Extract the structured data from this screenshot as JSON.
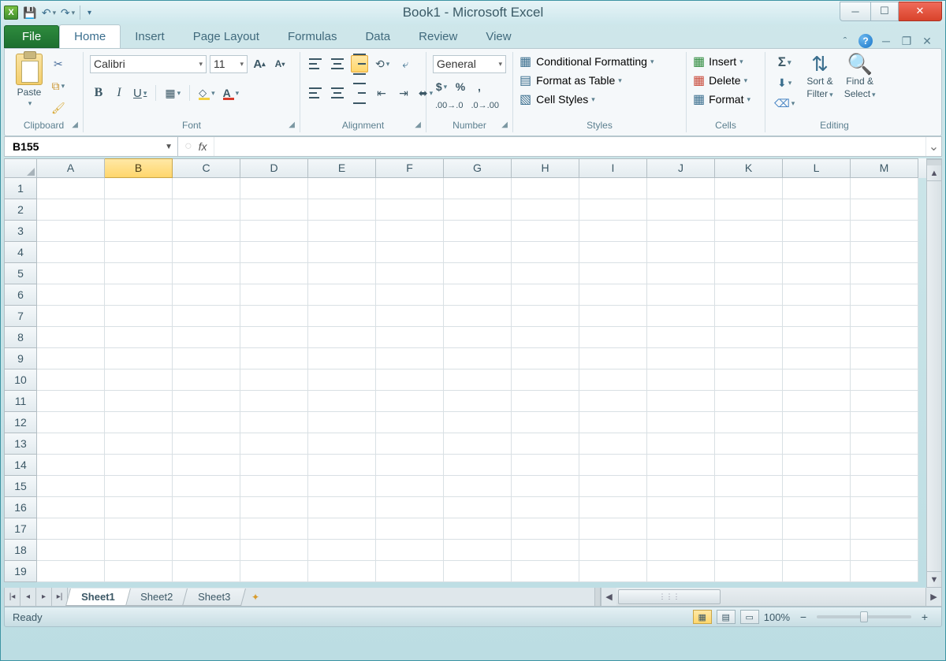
{
  "title": "Book1 - Microsoft Excel",
  "tabs": {
    "file": "File",
    "list": [
      "Home",
      "Insert",
      "Page Layout",
      "Formulas",
      "Data",
      "Review",
      "View"
    ],
    "active": "Home"
  },
  "ribbon": {
    "clipboard": {
      "label": "Clipboard",
      "paste": "Paste"
    },
    "font": {
      "label": "Font",
      "name": "Calibri",
      "size": "11",
      "bold": "B",
      "italic": "I",
      "underline": "U"
    },
    "alignment": {
      "label": "Alignment"
    },
    "number": {
      "label": "Number",
      "format": "General",
      "currency": "$",
      "percent": "%",
      "comma": ","
    },
    "styles": {
      "label": "Styles",
      "cond": "Conditional Formatting",
      "table": "Format as Table",
      "cell": "Cell Styles"
    },
    "cells": {
      "label": "Cells",
      "insert": "Insert",
      "delete": "Delete",
      "format": "Format"
    },
    "editing": {
      "label": "Editing",
      "sort": "Sort &",
      "filter": "Filter",
      "find": "Find &",
      "select": "Select",
      "sum": "Σ"
    }
  },
  "namebox": "B155",
  "columns": [
    "A",
    "B",
    "C",
    "D",
    "E",
    "F",
    "G",
    "H",
    "I",
    "J",
    "K",
    "L",
    "M"
  ],
  "selected_col": "B",
  "rows": [
    "1",
    "2",
    "3",
    "4",
    "5",
    "6",
    "7",
    "8",
    "9",
    "10",
    "11",
    "12",
    "13",
    "14",
    "15",
    "16",
    "17",
    "18",
    "19"
  ],
  "sheets": [
    "Sheet1",
    "Sheet2",
    "Sheet3"
  ],
  "active_sheet": "Sheet1",
  "status": {
    "ready": "Ready",
    "zoom": "100%"
  }
}
